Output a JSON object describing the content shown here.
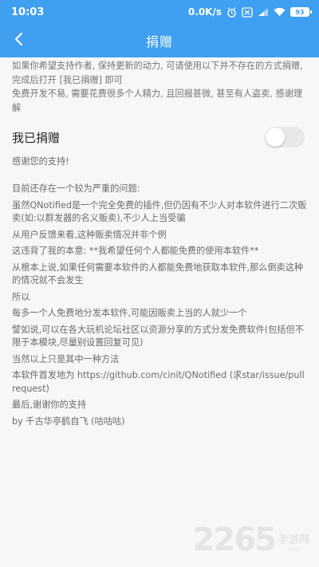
{
  "status_bar": {
    "time": "10:03",
    "speed": "0.0K/s",
    "battery": "93"
  },
  "app_bar": {
    "title": "捐赠"
  },
  "intro": {
    "line1": "如果你希望支持作者, 保持更新的动力, 可请使用以下并不存在的方式捐赠, 完成后打开 [我已捐赠] 即可",
    "line2": "免费开发不易, 需要花费很多个人精力, 且回报甚微, 甚至有人盗卖, 感谢理解"
  },
  "donated_toggle": {
    "label": "我已捐赠",
    "on": false
  },
  "thanks": "感谢您的支持!",
  "body": [
    "目前还存在一个较为严重的问题:",
    "  虽然QNotified是一个完全免费的插件,但仍因有不少人对本软件进行二次贩卖(如:以群发器的名义贩卖),不少人上当受骗",
    "从用户反馈来看,这种贩卖情况并非个例",
    "这违背了我的本意: **我希望任何个人都能免费的使用本软件**",
    "从根本上说,如果任何需要本软件的人都能免费地获取本软件,那么倒卖这种的情况就不会发生",
    "所以",
    "每多一个人免费地分发本软件,可能因贩卖上当的人就少一个",
    "譬如说,可以在各大玩机论坛社区以资源分享的方式分发免费软件(包括但不限于本模块,尽量别设置回复可见)",
    "当然以上只是其中一种方法",
    "本软件首发地为 https://github.com/cinit/QNotified (求star/issue/pull request)",
    "最后,谢谢你的支持",
    "by 千古华亭鹤自飞 (咕咕咕)"
  ],
  "watermark": {
    "number": "2265",
    "text": ".com",
    "brand": "手游网"
  },
  "colors": {
    "accent": "#3f9ff0",
    "background": "#f7f7f7"
  }
}
